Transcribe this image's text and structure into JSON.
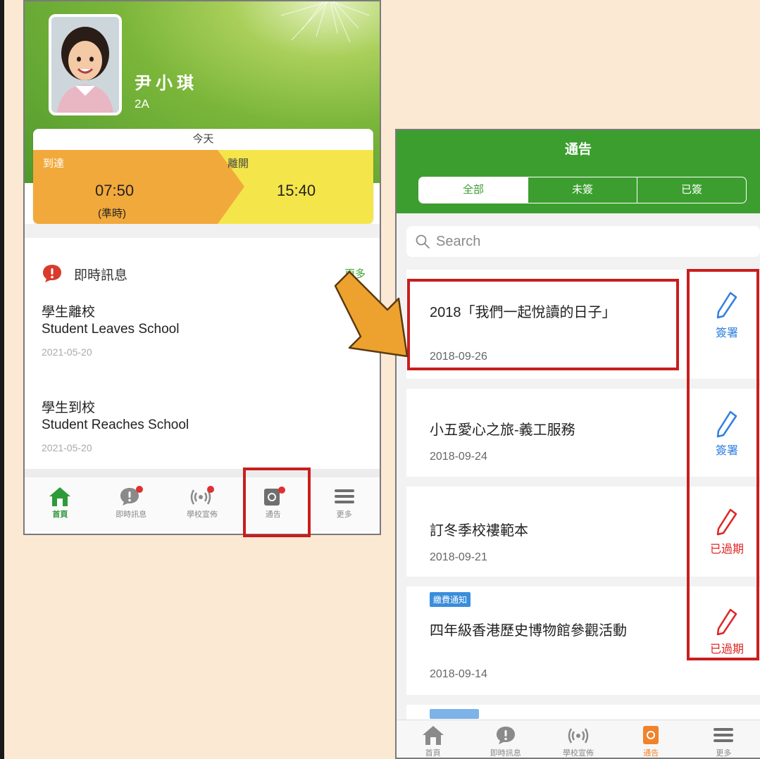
{
  "left": {
    "student": {
      "name": "尹小琪",
      "class": "2A"
    },
    "attendance": {
      "today_label": "今天",
      "arrive_label": "到達",
      "arrive_time": "07:50",
      "arrive_status": "(準時)",
      "leave_label": "離開",
      "leave_time": "15:40"
    },
    "messages": {
      "section_title": "即時訊息",
      "more_label": "更多",
      "items": [
        {
          "title_zh": "學生離校",
          "title_en": "Student Leaves School",
          "date": "2021-05-20"
        },
        {
          "title_zh": "學生到校",
          "title_en": "Student Reaches School",
          "date": "2021-05-20"
        }
      ]
    },
    "tabbar": [
      {
        "label": "首頁",
        "icon": "home-icon",
        "active": true
      },
      {
        "label": "即時訊息",
        "icon": "chat-icon",
        "active": false
      },
      {
        "label": "學校宣佈",
        "icon": "broadcast-icon",
        "active": false
      },
      {
        "label": "通告",
        "icon": "notice-icon",
        "active": false
      },
      {
        "label": "更多",
        "icon": "menu-icon",
        "active": false
      }
    ]
  },
  "right": {
    "title": "通告",
    "segments": [
      {
        "label": "全部",
        "active": true
      },
      {
        "label": "未簽",
        "active": false
      },
      {
        "label": "已簽",
        "active": false
      }
    ],
    "search": {
      "placeholder": "Search"
    },
    "notices": [
      {
        "badge": "",
        "title": "2018「我們一起悅讀的日子」",
        "date": "2018-09-26",
        "action": "簽署",
        "action_color": "#2f7fe0"
      },
      {
        "badge": "",
        "title": "小五愛心之旅-義工服務",
        "date": "2018-09-24",
        "action": "簽署",
        "action_color": "#2f7fe0"
      },
      {
        "badge": "",
        "title": "訂冬季校褸範本",
        "date": "2018-09-21",
        "action": "已過期",
        "action_color": "#e02424"
      },
      {
        "badge": "繳費通知",
        "title": "四年級香港歷史博物館參觀活動",
        "date": "2018-09-14",
        "action": "已過期",
        "action_color": "#e02424"
      }
    ],
    "tabbar": [
      {
        "label": "首頁",
        "icon": "home-icon",
        "active": false
      },
      {
        "label": "即時訊息",
        "icon": "chat-icon",
        "active": false
      },
      {
        "label": "學校宣佈",
        "icon": "broadcast-icon",
        "active": false
      },
      {
        "label": "通告",
        "icon": "notice-icon",
        "active": true
      },
      {
        "label": "更多",
        "icon": "menu-icon",
        "active": false
      }
    ]
  },
  "colors": {
    "green": "#3c9e2f",
    "orange": "#f2a93b",
    "yellow": "#f4e54a",
    "highlight_red": "#c81e1e",
    "arrow": "#eda22f"
  }
}
